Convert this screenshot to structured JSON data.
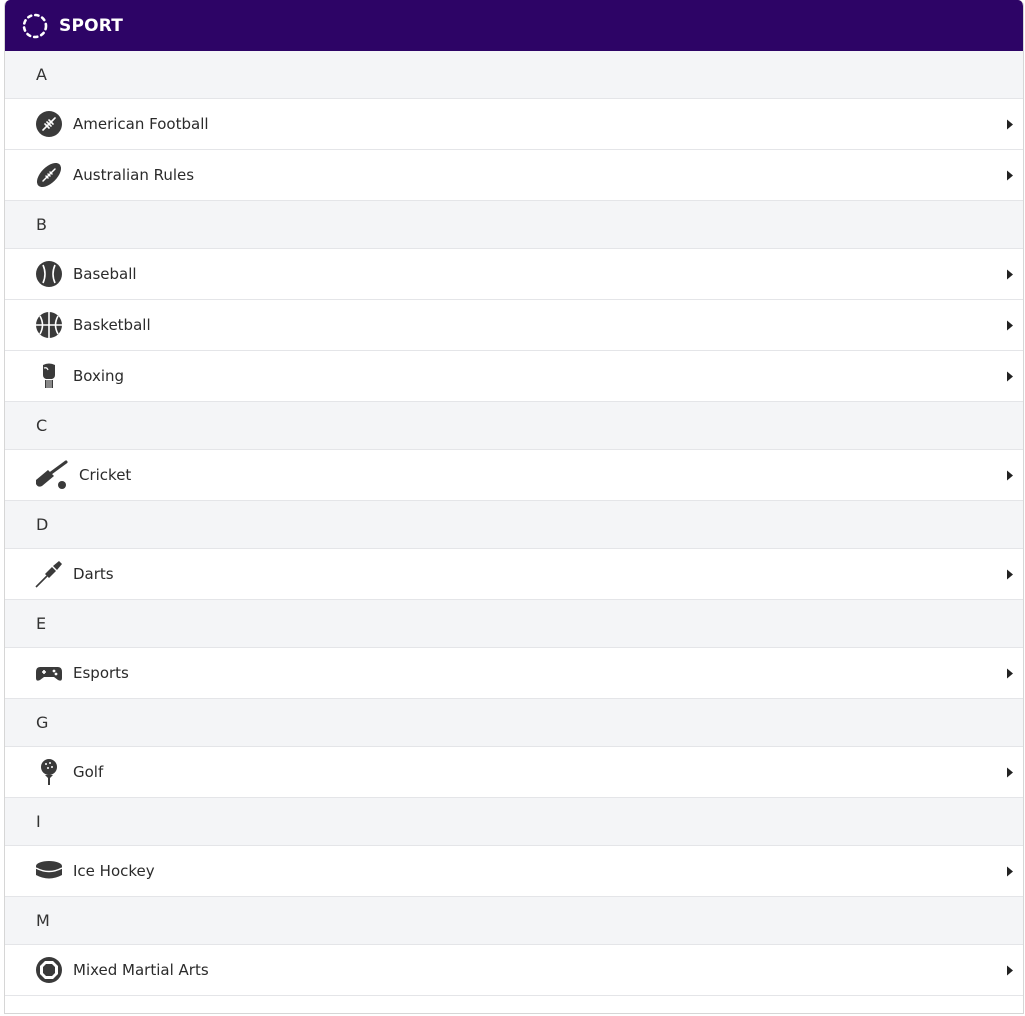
{
  "header": {
    "title": "SPORT"
  },
  "sections": {
    "a": {
      "letter": "A",
      "items": [
        "American Football",
        "Australian Rules"
      ]
    },
    "b": {
      "letter": "B",
      "items": [
        "Baseball",
        "Basketball",
        "Boxing"
      ]
    },
    "c": {
      "letter": "C",
      "items": [
        "Cricket"
      ]
    },
    "d": {
      "letter": "D",
      "items": [
        "Darts"
      ]
    },
    "e": {
      "letter": "E",
      "items": [
        "Esports"
      ]
    },
    "g": {
      "letter": "G",
      "items": [
        "Golf"
      ]
    },
    "i": {
      "letter": "I",
      "items": [
        "Ice Hockey"
      ]
    },
    "m": {
      "letter": "M",
      "items": [
        "Mixed Martial Arts"
      ]
    }
  },
  "colors": {
    "header_bg": "#2d0466",
    "section_bg": "#f4f5f7",
    "icon": "#3a3a3a"
  },
  "icons": [
    "american-football-icon",
    "australian-rules-icon",
    "baseball-icon",
    "basketball-icon",
    "boxing-glove-icon",
    "cricket-icon",
    "dart-icon",
    "gamepad-icon",
    "golf-icon",
    "hockey-puck-icon",
    "mma-octagon-icon"
  ]
}
